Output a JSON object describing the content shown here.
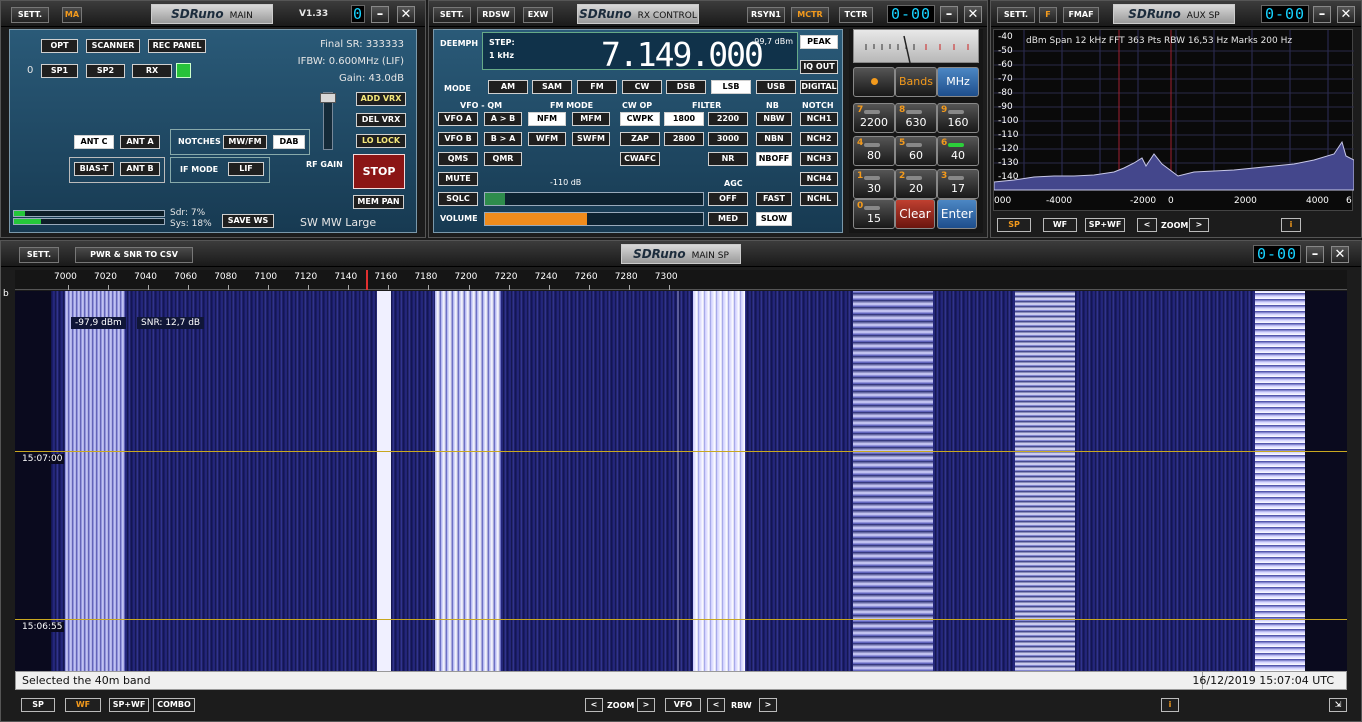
{
  "main_panel": {
    "sett": "SETT.",
    "ma": "MA",
    "logo": "SDRuno",
    "name": "MAIN",
    "version": "V1.33",
    "seg": "0",
    "buttons": {
      "opt": "OPT",
      "scanner": "SCANNER",
      "rec_panel": "REC PANEL",
      "zero": "0",
      "sp1": "SP1",
      "sp2": "SP2",
      "rx": "RX",
      "ant_c": "ANT C",
      "ant_a": "ANT A",
      "bias_t": "BIAS-T",
      "ant_b": "ANT B",
      "notches": "NOTCHES",
      "mwfm": "MW/FM",
      "dab": "DAB",
      "if_mode": "IF MODE",
      "lif": "LIF",
      "add_vrx": "ADD VRX",
      "del_vrx": "DEL VRX",
      "lo_lock": "LO LOCK",
      "stop": "STOP",
      "mem_pan": "MEM PAN",
      "save_ws": "SAVE WS",
      "rf_gain": "RF GAIN"
    },
    "final_sr": "Final SR: 333333",
    "ifbw": "IFBW: 0.600MHz (LIF)",
    "gain": "Gain: 43.0dB",
    "sdr": "Sdr: 7%",
    "sys": "Sys: 18%",
    "preset": "SW MW Large"
  },
  "rx_panel": {
    "sett": "SETT.",
    "rdsw": "RDSW",
    "exw": "EXW",
    "logo": "SDRuno",
    "name": "RX CONTROL",
    "rsyn1": "RSYN1",
    "mctr": "MCTR",
    "tctr": "TCTR",
    "seg": "0-00",
    "deemph": "DEEMPH",
    "step_label": "STEP:",
    "step_val": "1 kHz",
    "frequency": "7.149.000",
    "dbm": "-99,7 dBm",
    "peak": "PEAK",
    "iq_out": "IQ OUT",
    "digital": "DIGITAL",
    "mode_label": "MODE",
    "modes": [
      "AM",
      "SAM",
      "FM",
      "CW",
      "DSB",
      "LSB",
      "USB"
    ],
    "vfo_qm": "VFO - QM",
    "fm_mode": "FM MODE",
    "cw_op": "CW OP",
    "filter": "FILTER",
    "nb": "NB",
    "notch": "NOTCH",
    "vfo_a": "VFO A",
    "a_b": "A > B",
    "nfm": "NFM",
    "mfm": "MFM",
    "cwpk": "CWPK",
    "f1800": "1800",
    "f2200": "2200",
    "nbw": "NBW",
    "nch1": "NCH1",
    "vfo_b": "VFO B",
    "b_a": "B > A",
    "wfm": "WFM",
    "swfm": "SWFM",
    "zap": "ZAP",
    "f2800": "2800",
    "f3000": "3000",
    "nbn": "NBN",
    "nch2": "NCH2",
    "qms": "QMS",
    "qmr": "QMR",
    "cwafc": "CWAFC",
    "nr": "NR",
    "nboff": "NBOFF",
    "nch3": "NCH3",
    "mute": "MUTE",
    "agc": "AGC",
    "nch4": "NCH4",
    "sqlc": "SQLC",
    "sql_db": "-110 dB",
    "off": "OFF",
    "fast": "FAST",
    "nchl": "NCHL",
    "volume": "VOLUME",
    "med": "MED",
    "slow": "SLOW",
    "squelch_level": 0.09,
    "volume_level": 0.47,
    "smeter": "S-meter"
  },
  "keypad": {
    "bands": "Bands",
    "mhz": "MHz",
    "clear": "Clear",
    "enter": "Enter",
    "keys": [
      {
        "n": "7",
        "v": "2200"
      },
      {
        "n": "8",
        "v": "630"
      },
      {
        "n": "9",
        "v": "160"
      },
      {
        "n": "4",
        "v": "80"
      },
      {
        "n": "5",
        "v": "60"
      },
      {
        "n": "6",
        "v": "40"
      },
      {
        "n": "1",
        "v": "30"
      },
      {
        "n": "2",
        "v": "20"
      },
      {
        "n": "3",
        "v": "17"
      },
      {
        "n": "0",
        "v": "15"
      }
    ]
  },
  "aux_panel": {
    "sett": "SETT.",
    "f": "F",
    "fmaf": "FMAF",
    "logo": "SDRuno",
    "name": "AUX SP",
    "seg": "0-00",
    "info": "dBm  Span 12 kHz   FFT 363 Pts   RBW 16,53 Hz   Marks 200 Hz",
    "ylabels": [
      "-40",
      "-50",
      "-60",
      "-70",
      "-80",
      "-90",
      "-100",
      "-110",
      "-120",
      "-130",
      "-140"
    ],
    "xlabels": [
      "000",
      "-4000",
      "-2000",
      "0",
      "2000",
      "4000",
      "6"
    ],
    "sp": "SP",
    "wf": "WF",
    "spwf": "SP+WF",
    "zoom": "ZOOM",
    "info_btn": "i"
  },
  "main_sp": {
    "sett": "SETT.",
    "pwr_snr": "PWR & SNR TO CSV",
    "logo": "SDRuno",
    "name": "MAIN SP",
    "seg": "0-00",
    "freq_labels": [
      "7000",
      "7020",
      "7040",
      "7060",
      "7080",
      "7100",
      "7120",
      "7140",
      "7160",
      "7180",
      "7200",
      "7220",
      "7240",
      "7260",
      "7280",
      "7300"
    ],
    "left_marker": "b",
    "readout_dbm": "-97,9 dBm",
    "readout_snr": "SNR: 12,7 dB",
    "time1": "15:07:00",
    "time2": "15:06:55",
    "status": "Selected the 40m band",
    "datetime": "16/12/2019 15:07:04 UTC",
    "bottom": {
      "sp": "SP",
      "wf": "WF",
      "spwf": "SP+WF",
      "combo": "COMBO",
      "zoom": "ZOOM",
      "vfo": "VFO",
      "rbw": "RBW",
      "info": "i",
      "lt": "<",
      "gt": ">"
    }
  }
}
